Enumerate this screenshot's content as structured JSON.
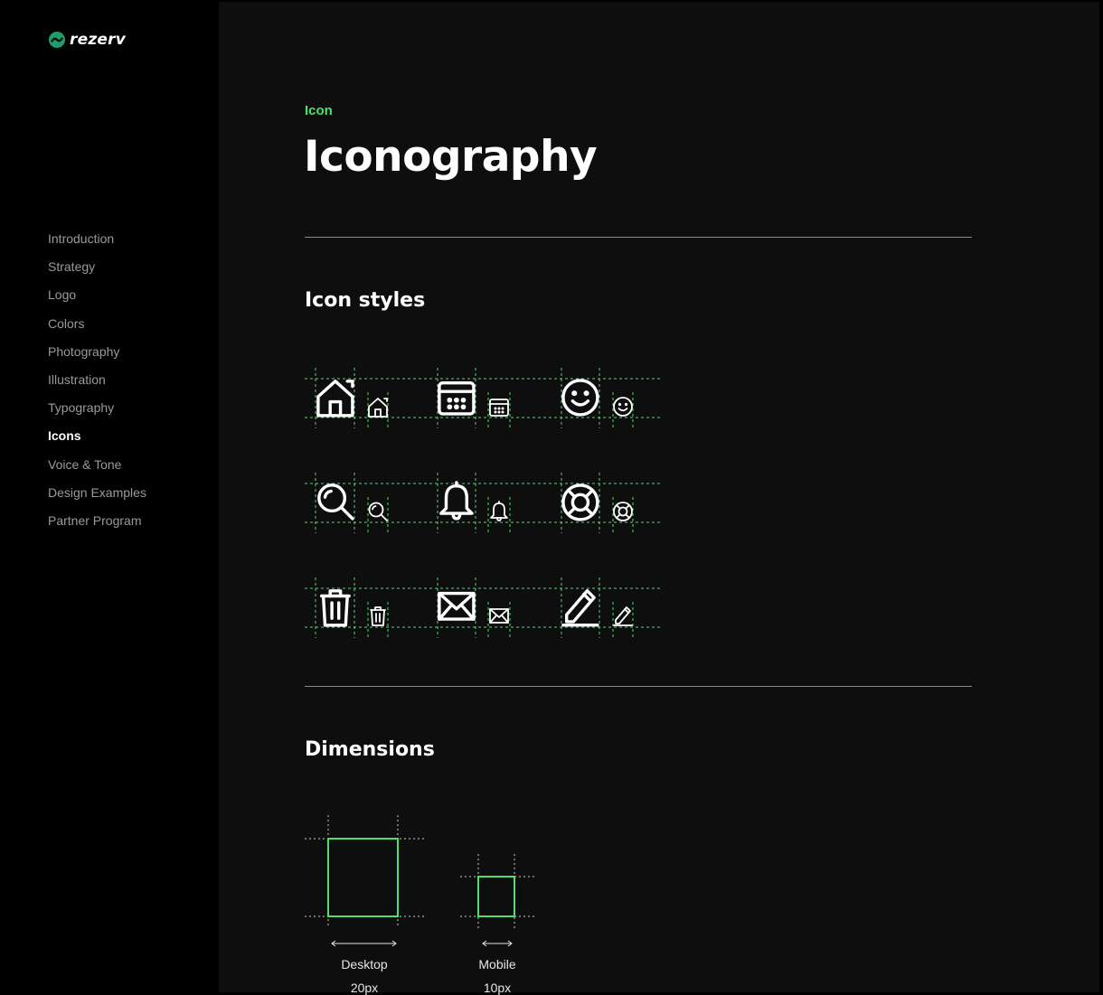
{
  "brand": {
    "name": "rezerv",
    "accent": "#4ee06b"
  },
  "nav": {
    "items": [
      "Introduction",
      "Strategy",
      "Logo",
      "Colors",
      "Photography",
      "Illustration",
      "Typography",
      "Icons",
      "Voice & Tone",
      "Design Examples",
      "Partner Program"
    ],
    "active": "Icons"
  },
  "header": {
    "eyebrow": "Icon",
    "title": "Iconography"
  },
  "sections": {
    "icon_styles": {
      "heading": "Icon styles"
    },
    "dimensions": {
      "heading": "Dimensions",
      "desktop": {
        "label": "Desktop",
        "size": "20px"
      },
      "mobile": {
        "label": "Mobile",
        "size": "10px"
      }
    }
  },
  "icons": [
    "home-icon",
    "calendar-icon",
    "smiley-icon",
    "search-icon",
    "bell-icon",
    "lifebuoy-icon",
    "trash-icon",
    "mail-icon",
    "pencil-icon"
  ]
}
